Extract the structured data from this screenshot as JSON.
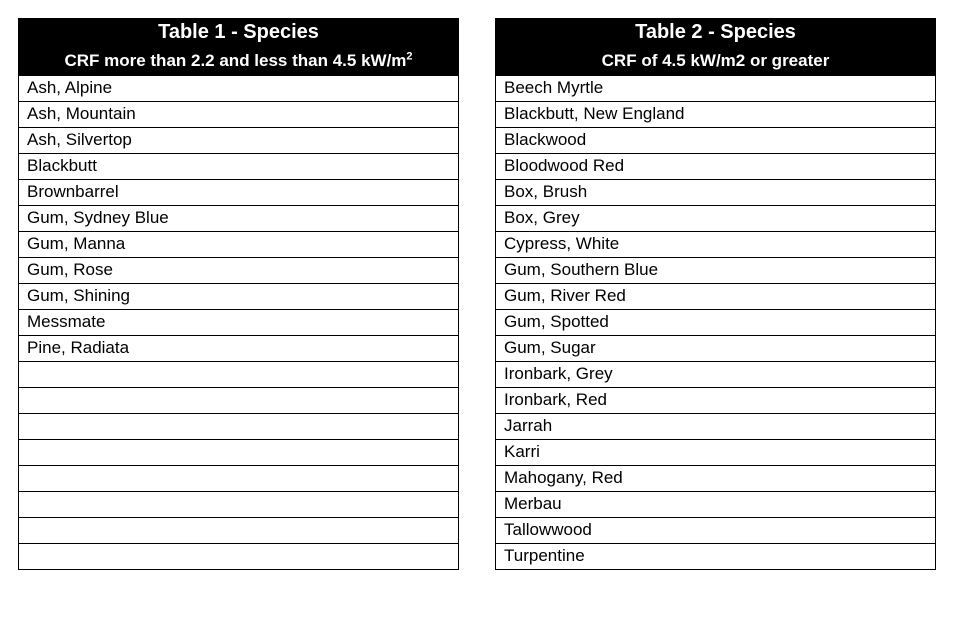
{
  "table1": {
    "title": "Table 1 - Species",
    "subtitle_prefix": "CRF more than 2.2 and less than 4.5 kW/m",
    "subtitle_exp": "2",
    "rows": [
      "Ash, Alpine",
      "Ash, Mountain",
      "Ash, Silvertop",
      "Blackbutt",
      "Brownbarrel",
      "Gum, Sydney Blue",
      "Gum, Manna",
      "Gum, Rose",
      "Gum, Shining",
      "Messmate",
      "Pine, Radiata",
      "",
      "",
      "",
      "",
      "",
      "",
      "",
      ""
    ]
  },
  "table2": {
    "title": "Table 2 - Species",
    "subtitle": "CRF of 4.5 kW/m2 or greater",
    "rows": [
      "Beech Myrtle",
      "Blackbutt, New England",
      "Blackwood",
      "Bloodwood Red",
      "Box, Brush",
      "Box, Grey",
      "Cypress, White",
      "Gum, Southern Blue",
      "Gum, River Red",
      "Gum, Spotted",
      "Gum, Sugar",
      "Ironbark, Grey",
      "Ironbark, Red",
      "Jarrah",
      "Karri",
      "Mahogany, Red",
      "Merbau",
      "Tallowwood",
      "Turpentine"
    ]
  }
}
